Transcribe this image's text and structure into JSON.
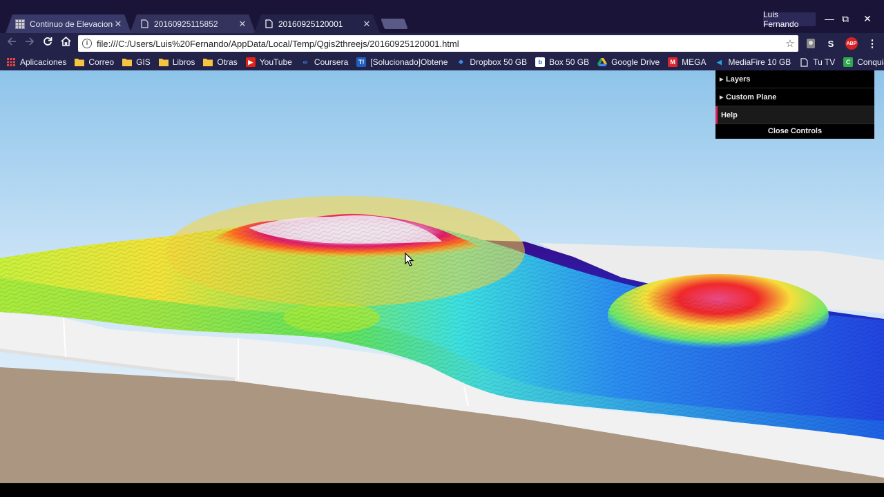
{
  "tabs": [
    {
      "title": "Continuo de Elevaciones",
      "icon": "grid-map-icon",
      "active": false
    },
    {
      "title": "20160925115852",
      "icon": "page-icon",
      "active": false
    },
    {
      "title": "20160925120001",
      "icon": "page-icon",
      "active": true
    }
  ],
  "profile": "Luis Fernando",
  "window_controls": {
    "minimize": "—",
    "restore": "⧉",
    "close": "✕"
  },
  "toolbar": {
    "url": "file:///C:/Users/Luis%20Fernando/AppData/Local/Temp/Qgis2threejs/20160925120001.html",
    "extensions": {
      "s": "S",
      "abp": "ABP"
    }
  },
  "bookmarks": [
    {
      "label": "Aplicaciones",
      "icon": "apps-grid-icon"
    },
    {
      "label": "Correo",
      "icon": "folder-icon"
    },
    {
      "label": "GIS",
      "icon": "folder-icon"
    },
    {
      "label": "Libros",
      "icon": "folder-icon"
    },
    {
      "label": "Otras",
      "icon": "folder-icon"
    },
    {
      "label": "YouTube",
      "icon": "youtube-icon"
    },
    {
      "label": "Coursera",
      "icon": "coursera-icon"
    },
    {
      "label": "[Solucionado]Obtene",
      "icon": "t-icon"
    },
    {
      "label": "Dropbox 50 GB",
      "icon": "dropbox-icon"
    },
    {
      "label": "Box 50 GB",
      "icon": "box-icon"
    },
    {
      "label": "Google Drive",
      "icon": "google-drive-icon"
    },
    {
      "label": "MEGA",
      "icon": "mega-icon"
    },
    {
      "label": "MediaFire 10 GB",
      "icon": "mediafire-icon"
    },
    {
      "label": "Tu TV",
      "icon": "page-icon"
    },
    {
      "label": "Conquian",
      "icon": "conquian-icon"
    }
  ],
  "controls": {
    "layers": "Layers",
    "custom_plane": "Custom Plane",
    "help": "Help",
    "close": "Close Controls"
  },
  "colors": {
    "titlebar": "#1a1538",
    "toolbar": "#23234a",
    "sky_top": "#8ec4ea",
    "sky_bottom": "#eef6fc",
    "base_side": "#ab9682",
    "help_accent": "#e61d5f"
  }
}
